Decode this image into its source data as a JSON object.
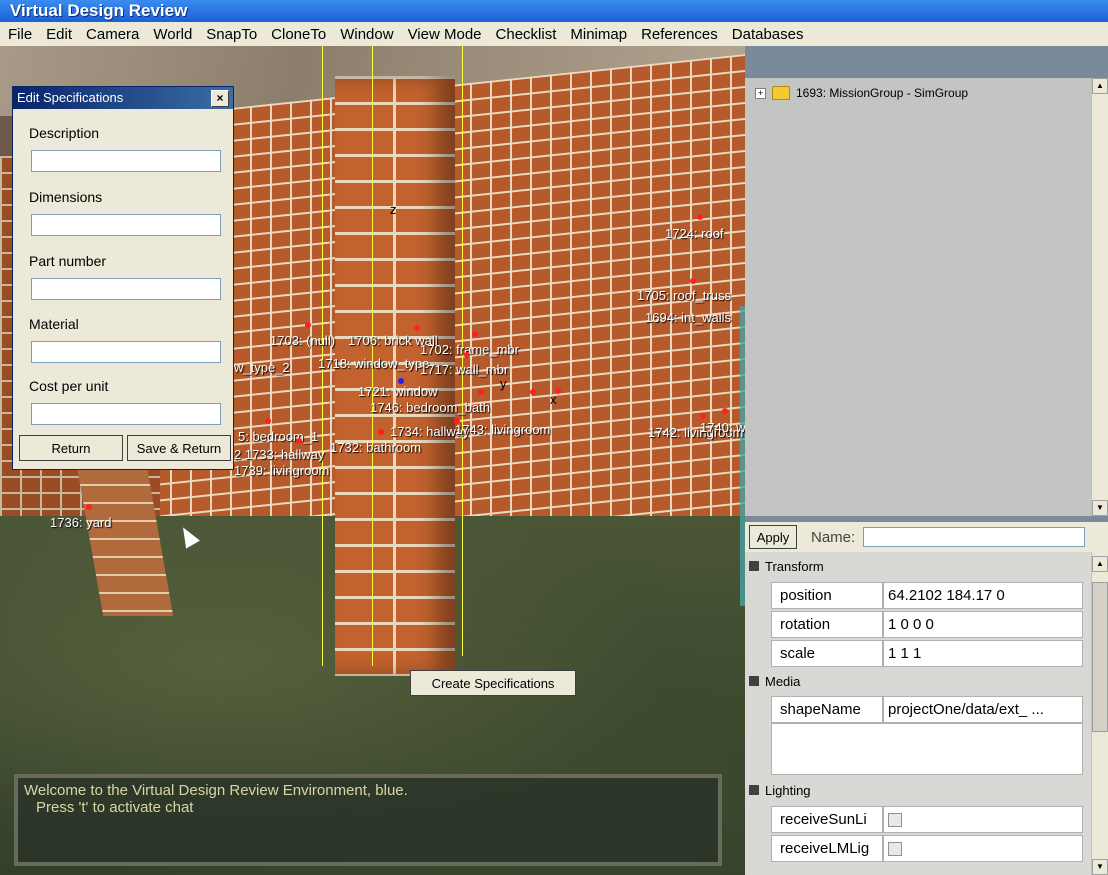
{
  "window": {
    "title": "Virtual Design Review"
  },
  "menu": [
    "File",
    "Edit",
    "Camera",
    "World",
    "SnapTo",
    "CloneTo",
    "Window",
    "View Mode",
    "Checklist",
    "Minimap",
    "References",
    "Databases"
  ],
  "dialog": {
    "title": "Edit Specifications",
    "close_glyph": "×",
    "fields": [
      {
        "label": "Description",
        "value": ""
      },
      {
        "label": "Dimensions",
        "value": ""
      },
      {
        "label": "Part number",
        "value": ""
      },
      {
        "label": "Material",
        "value": ""
      },
      {
        "label": "Cost per unit",
        "value": ""
      }
    ],
    "return_label": "Return",
    "save_return_label": "Save & Return"
  },
  "scene": {
    "create_button": "Create Specifications",
    "labels": [
      "1724: roof",
      "1705: roof_truss",
      "1694: int_walls",
      "1703: (null)",
      "1706: brick wall",
      "1702: frame_mbr",
      "w_type_2",
      "1718: window_type",
      "1717: wall_mbr",
      "1721: window",
      "1746: bedroom_bath",
      "5: bedroom_1",
      "1734: hallway",
      "1743: livingroom",
      "1742: livingroom",
      "1740: w",
      "2 1733: hallway",
      "1732: bathroom",
      "1739: livingroom",
      "1736: yard",
      "z",
      "y",
      "x"
    ]
  },
  "chat": {
    "line1": "Welcome to the Virtual Design Review Environment, blue.",
    "line2": "Press 't' to activate chat"
  },
  "tree": {
    "root": "1693: MissionGroup - SimGroup",
    "expand_glyph": "+"
  },
  "namebar": {
    "apply_label": "Apply",
    "name_label": "Name:",
    "name_value": ""
  },
  "inspector": {
    "groups": [
      {
        "title": "Transform",
        "props": [
          {
            "key": "position",
            "value": "64.2102 184.17 0"
          },
          {
            "key": "rotation",
            "value": "1 0 0 0"
          },
          {
            "key": "scale",
            "value": "1 1 1"
          }
        ]
      },
      {
        "title": "Media",
        "props": [
          {
            "key": "shapeName",
            "value": "projectOne/data/ext_ ..."
          }
        ]
      },
      {
        "title": "Lighting",
        "props": [
          {
            "key": "receiveSunLi",
            "value": ""
          },
          {
            "key": "receiveLMLig",
            "value": ""
          }
        ]
      }
    ]
  },
  "colors": {
    "titlebar": "#1f64d8",
    "brick": "#b65a2c",
    "grass": "#4a5636",
    "marker": "#ff2020",
    "chat_text": "#d8d6a0"
  }
}
